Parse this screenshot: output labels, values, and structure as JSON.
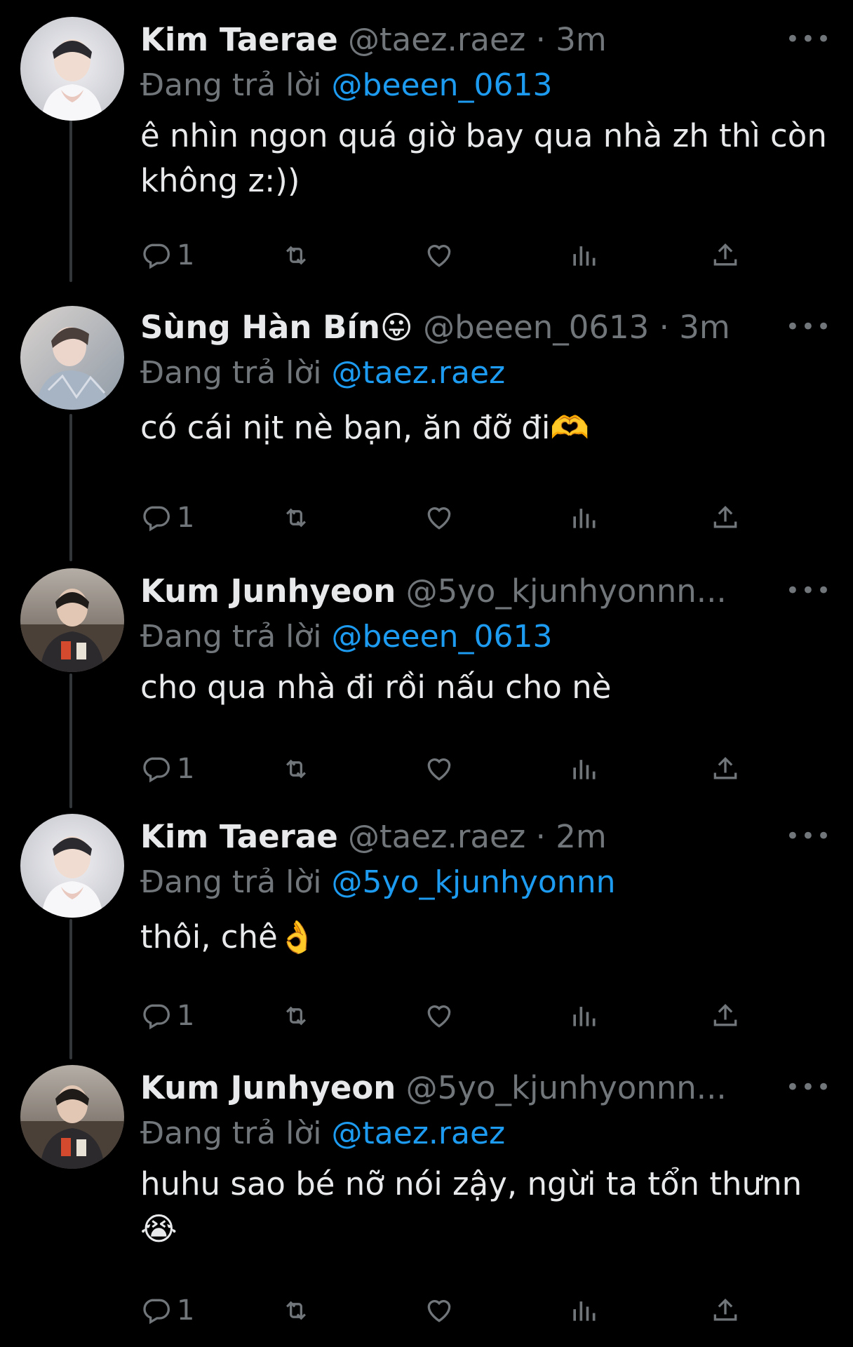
{
  "colors": {
    "background": "#000000",
    "text": "#e7e9ea",
    "muted": "#71767b",
    "accent": "#1d9bf0"
  },
  "tweets": [
    {
      "name": "Kim Taerae",
      "handle": "@taez.raez",
      "separator": "·",
      "time": "3m",
      "replying_prefix": "Đang trả lời",
      "reply_to": "@beeen_0613",
      "text": "ê nhìn ngon quá giờ bay qua nhà zh thì còn không z:))",
      "reply_count": "1",
      "avatar": "avatar-kim-taerae"
    },
    {
      "name": "Sùng Hàn Bín😛",
      "handle": "@beeen_0613",
      "separator": "·",
      "time": "3m",
      "replying_prefix": "Đang trả lời",
      "reply_to": "@taez.raez",
      "text": "có cái nịt nè bạn, ăn đỡ đi🫶",
      "reply_count": "1",
      "avatar": "avatar-sung-han-bin"
    },
    {
      "name": "Kum Junhyeon",
      "handle": "@5yo_kjunhyonnn...",
      "separator": "",
      "time": "",
      "replying_prefix": "Đang trả lời",
      "reply_to": "@beeen_0613",
      "text": "cho qua nhà đi rồi nấu cho nè",
      "reply_count": "1",
      "avatar": "avatar-kum-junhyeon"
    },
    {
      "name": "Kim Taerae",
      "handle": "@taez.raez",
      "separator": "·",
      "time": "2m",
      "replying_prefix": "Đang trả lời",
      "reply_to": "@5yo_kjunhyonnn",
      "text": "thôi, chê👌",
      "reply_count": "1",
      "avatar": "avatar-kim-taerae"
    },
    {
      "name": "Kum Junhyeon",
      "handle": "@5yo_kjunhyonnn...",
      "separator": "",
      "time": "",
      "replying_prefix": "Đang trả lời",
      "reply_to": "@taez.raez",
      "text": "huhu sao bé nỡ nói zậy, ngừi ta tổn thưnn😭",
      "reply_count": "1",
      "avatar": "avatar-kum-junhyeon"
    }
  ],
  "icons": {
    "more": "more-horizontal-icon",
    "reply": "reply-icon",
    "retweet": "retweet-icon",
    "like": "heart-icon",
    "views": "views-icon",
    "share": "share-icon"
  }
}
